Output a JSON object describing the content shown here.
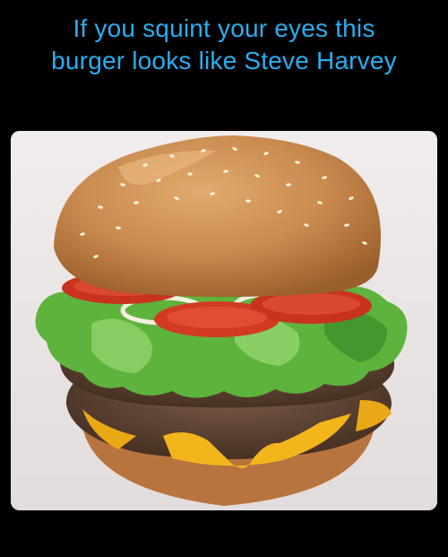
{
  "caption": {
    "line1": "If you squint your eyes this",
    "line2": "burger looks like Steve Harvey"
  },
  "image": {
    "subject": "burger-photo",
    "colors": {
      "background": "#000000",
      "caption_text": "#2aaef0",
      "photo_bg": "#ece8e9",
      "bun": "#c98a4e",
      "tomato": "#c8321f",
      "lettuce": "#5db33c",
      "patty": "#5a4030",
      "cheese": "#f2b51c"
    }
  }
}
